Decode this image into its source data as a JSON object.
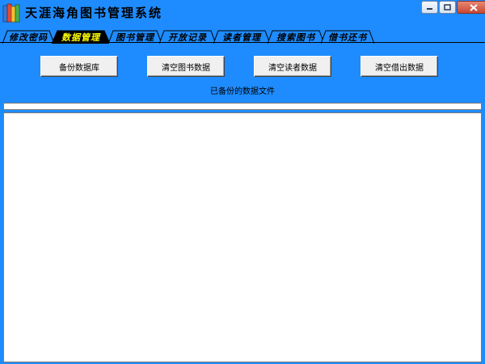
{
  "app": {
    "title": "天涯海角图书管理系统"
  },
  "window_controls": {
    "minimize_icon": "minimize-icon",
    "maximize_icon": "maximize-icon",
    "close_icon": "close-icon"
  },
  "tabs": [
    {
      "label": "修改密码",
      "active": false
    },
    {
      "label": "数据管理",
      "active": true
    },
    {
      "label": "图书管理",
      "active": false
    },
    {
      "label": "开放记录",
      "active": false
    },
    {
      "label": "读者管理",
      "active": false
    },
    {
      "label": "搜索图书",
      "active": false
    },
    {
      "label": "借书还书",
      "active": false
    }
  ],
  "actions": {
    "backup_label": "备份数据库",
    "clear_books_label": "清空图书数据",
    "clear_readers_label": "清空读者数据",
    "clear_loans_label": "清空借出数据"
  },
  "backup_list": {
    "label": "已备份的数据文件",
    "items": []
  },
  "progress": {
    "value": 0
  },
  "colors": {
    "background": "#1e8cff",
    "active_tab_text": "#ffff00"
  }
}
